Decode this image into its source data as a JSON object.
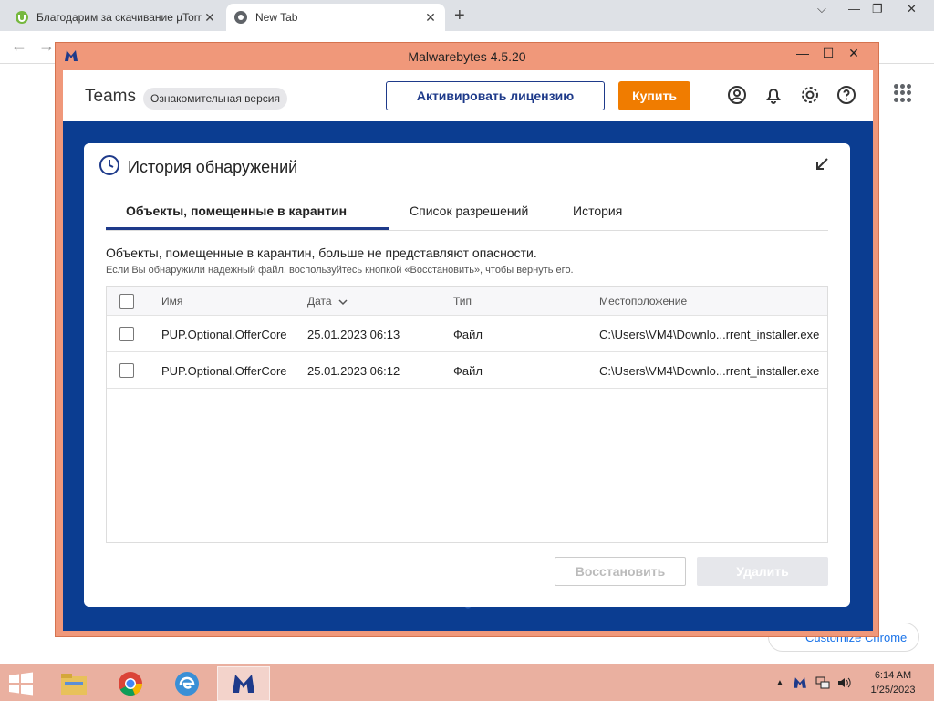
{
  "browser": {
    "tabs": [
      {
        "title": "Благодарим за скачивание µTorrent",
        "close": "✕"
      },
      {
        "title": "New Tab",
        "close": "✕"
      }
    ],
    "new_tab": "+",
    "window_controls": {
      "min": "⌵",
      "minimize": "—",
      "restore": "❐",
      "close": "✕"
    },
    "back": "←",
    "forward": "→",
    "customize": "Customize Chrome"
  },
  "malwarebytes": {
    "window_title": "Malwarebytes 4.5.20",
    "window_controls": {
      "minimize": "—",
      "maximize": "☐",
      "close": "✕"
    },
    "header": {
      "teams": "Teams",
      "trial_badge": "Ознакомительная версия",
      "activate": "Активировать лицензию",
      "buy": "Купить"
    },
    "panel": {
      "title": "История обнаружений",
      "tabs": [
        {
          "label": "Объекты, помещенные в карантин"
        },
        {
          "label": "Список разрешений"
        },
        {
          "label": "История"
        }
      ],
      "description": "Объекты, помещенные в карантин, больше не представляют опасности.",
      "hint": "Если Вы обнаружили надежный файл, воспользуйтесь кнопкой «Восстановить», чтобы вернуть его.",
      "columns": {
        "name": "Имя",
        "date": "Дата",
        "type": "Тип",
        "location": "Местоположение"
      },
      "rows": [
        {
          "name": "PUP.Optional.OfferCore",
          "date": "25.01.2023 06:13",
          "type": "Файл",
          "location": "C:\\Users\\VM4\\Downlo...rrent_installer.exe"
        },
        {
          "name": "PUP.Optional.OfferCore",
          "date": "25.01.2023 06:12",
          "type": "Файл",
          "location": "C:\\Users\\VM4\\Downlo...rrent_installer.exe"
        }
      ],
      "restore": "Восстановить",
      "delete": "Удалить"
    }
  },
  "taskbar": {
    "time": "6:14 AM",
    "date": "1/25/2023",
    "tray_arrow": "▲"
  },
  "colors": {
    "accent": "#1e3a8a",
    "buy": "#f07c00",
    "window_border": "#f0987a",
    "content_bg": "#0b3d91"
  }
}
